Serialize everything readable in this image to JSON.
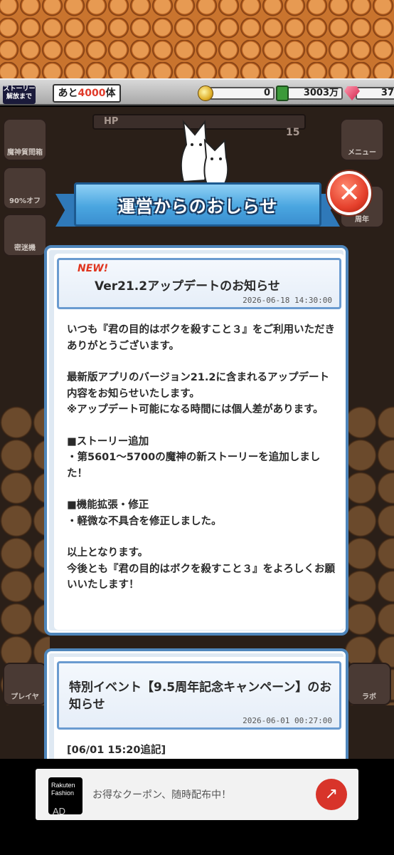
{
  "resources": {
    "story_label": "ストーリー解放まで",
    "story_remaining_prefix": "あと",
    "story_remaining_count": "4000",
    "story_remaining_suffix": "体",
    "coins": "0",
    "hours": "3003万",
    "gems": "37"
  },
  "background": {
    "hp_label": "HP",
    "level": "15",
    "side_buttons": {
      "box": "魔神質問箱",
      "discount": "90%オフ",
      "dungeon": "密迷機",
      "menu": "メニュー",
      "player": "プレイヤ",
      "lab": "ラボ",
      "anniversary": "周年"
    }
  },
  "banner": {
    "title": "運営からのおしらせ"
  },
  "notices": [
    {
      "badge": "NEW!",
      "title": "Ver21.2アップデートのお知らせ",
      "date": "2026-06-18 14:30:00",
      "body": [
        "いつも『君の目的はボクを殺すこと３』をご利用いただきありがとうございます。",
        "最新版アプリのバージョン21.2に含まれるアップデート内容をお知らせいたします。\n※アップデート可能になる時間には個人差があります。",
        "■ストーリー追加\n・第5601〜5700の魔神の新ストーリーを追加しました！",
        "■機能拡張・修正\n・軽微な不具合を修正しました。",
        "以上となります。\n今後とも『君の目的はボクを殺すこと３』をよろしくお願いいたします！"
      ]
    },
    {
      "title": "特別イベント【9.5周年記念キャンペーン】のお知らせ",
      "date": "2026-06-01 00:27:00",
      "body_first_line": "[06/01 15:20追記]"
    }
  ],
  "ad": {
    "brand": "Rakuten Fashion",
    "text": "お得なクーポン、随時配布中！",
    "label": "AD"
  },
  "colors": {
    "banner": "#4aa6e0",
    "close": "#e5402c",
    "modal_border": "#4f86bb",
    "new_badge": "#e0341e"
  }
}
